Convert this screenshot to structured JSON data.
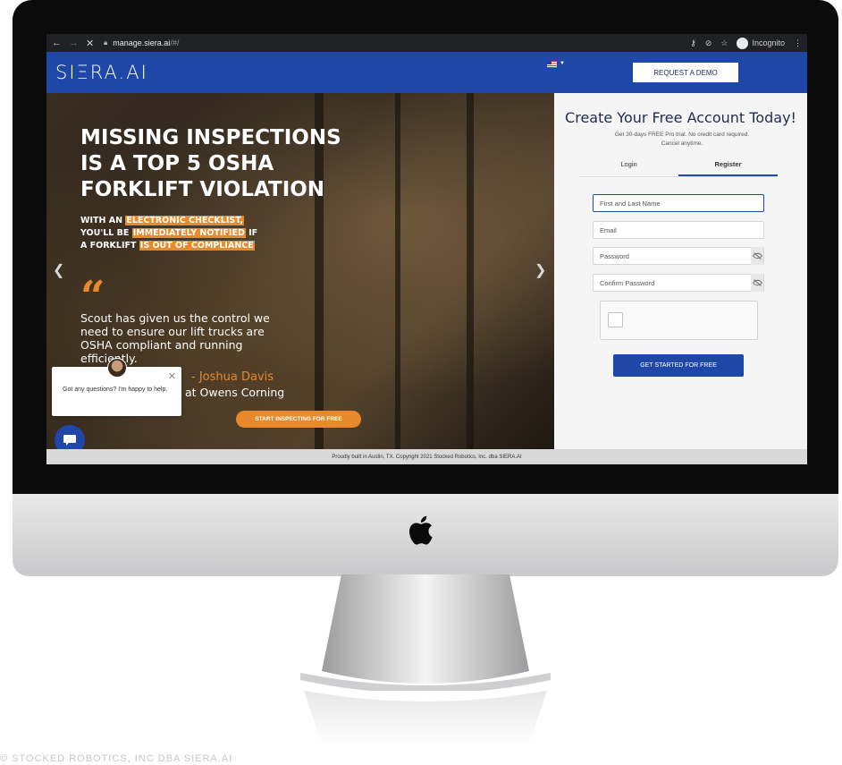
{
  "browser": {
    "url_host": "manage.siera.ai",
    "url_path": "/#/",
    "profile_label": "Incognito"
  },
  "site": {
    "logo": "SIΞRA.AI",
    "demo_button": "REQUEST A DEMO"
  },
  "hero": {
    "headline_1": "MISSING INSPECTIONS",
    "headline_2": "IS A TOP 5 OSHA",
    "headline_3": "FORKLIFT VIOLATION",
    "sub_1a": "WITH AN ",
    "sub_1b": "ELECTRONIC CHECKLIST,",
    "sub_2a": "YOU'LL BE ",
    "sub_2b": "IMMEDIATELY NOTIFIED",
    "sub_2c": " IF",
    "sub_3a": "A FORKLIFT ",
    "sub_3b": "IS OUT OF COMPLIANCE",
    "quote": "Scout has given us the control we need to ensure our lift trucks are OSHA compliant and running efficiently.",
    "author": "- Joshua Davis",
    "company": "at Owens Corning",
    "cta": "START INSPECTING FOR FREE"
  },
  "chat": {
    "message": "Got any questions? I'm happy to help."
  },
  "form": {
    "title": "Create Your Free Account Today!",
    "subtitle_1": "Get 30-days FREE Pro trial. No credit card required.",
    "subtitle_2": "Cancel anytime.",
    "tab_login": "Login",
    "tab_register": "Register",
    "name_placeholder": "First and Last Name",
    "email_placeholder": "Email",
    "password_placeholder": "Password",
    "confirm_placeholder": "Confirm Password",
    "submit": "GET STARTED FOR FREE"
  },
  "footer": {
    "text": "Proudly built in Austin, TX. Copyright 2021 Stocked Robotics, Inc. dba SIERA.AI"
  },
  "caption": "© STOCKED ROBOTICS, INC DBA SIERA.AI",
  "colors": {
    "brand_blue": "#1e47a8",
    "accent_orange": "#e8892b"
  }
}
